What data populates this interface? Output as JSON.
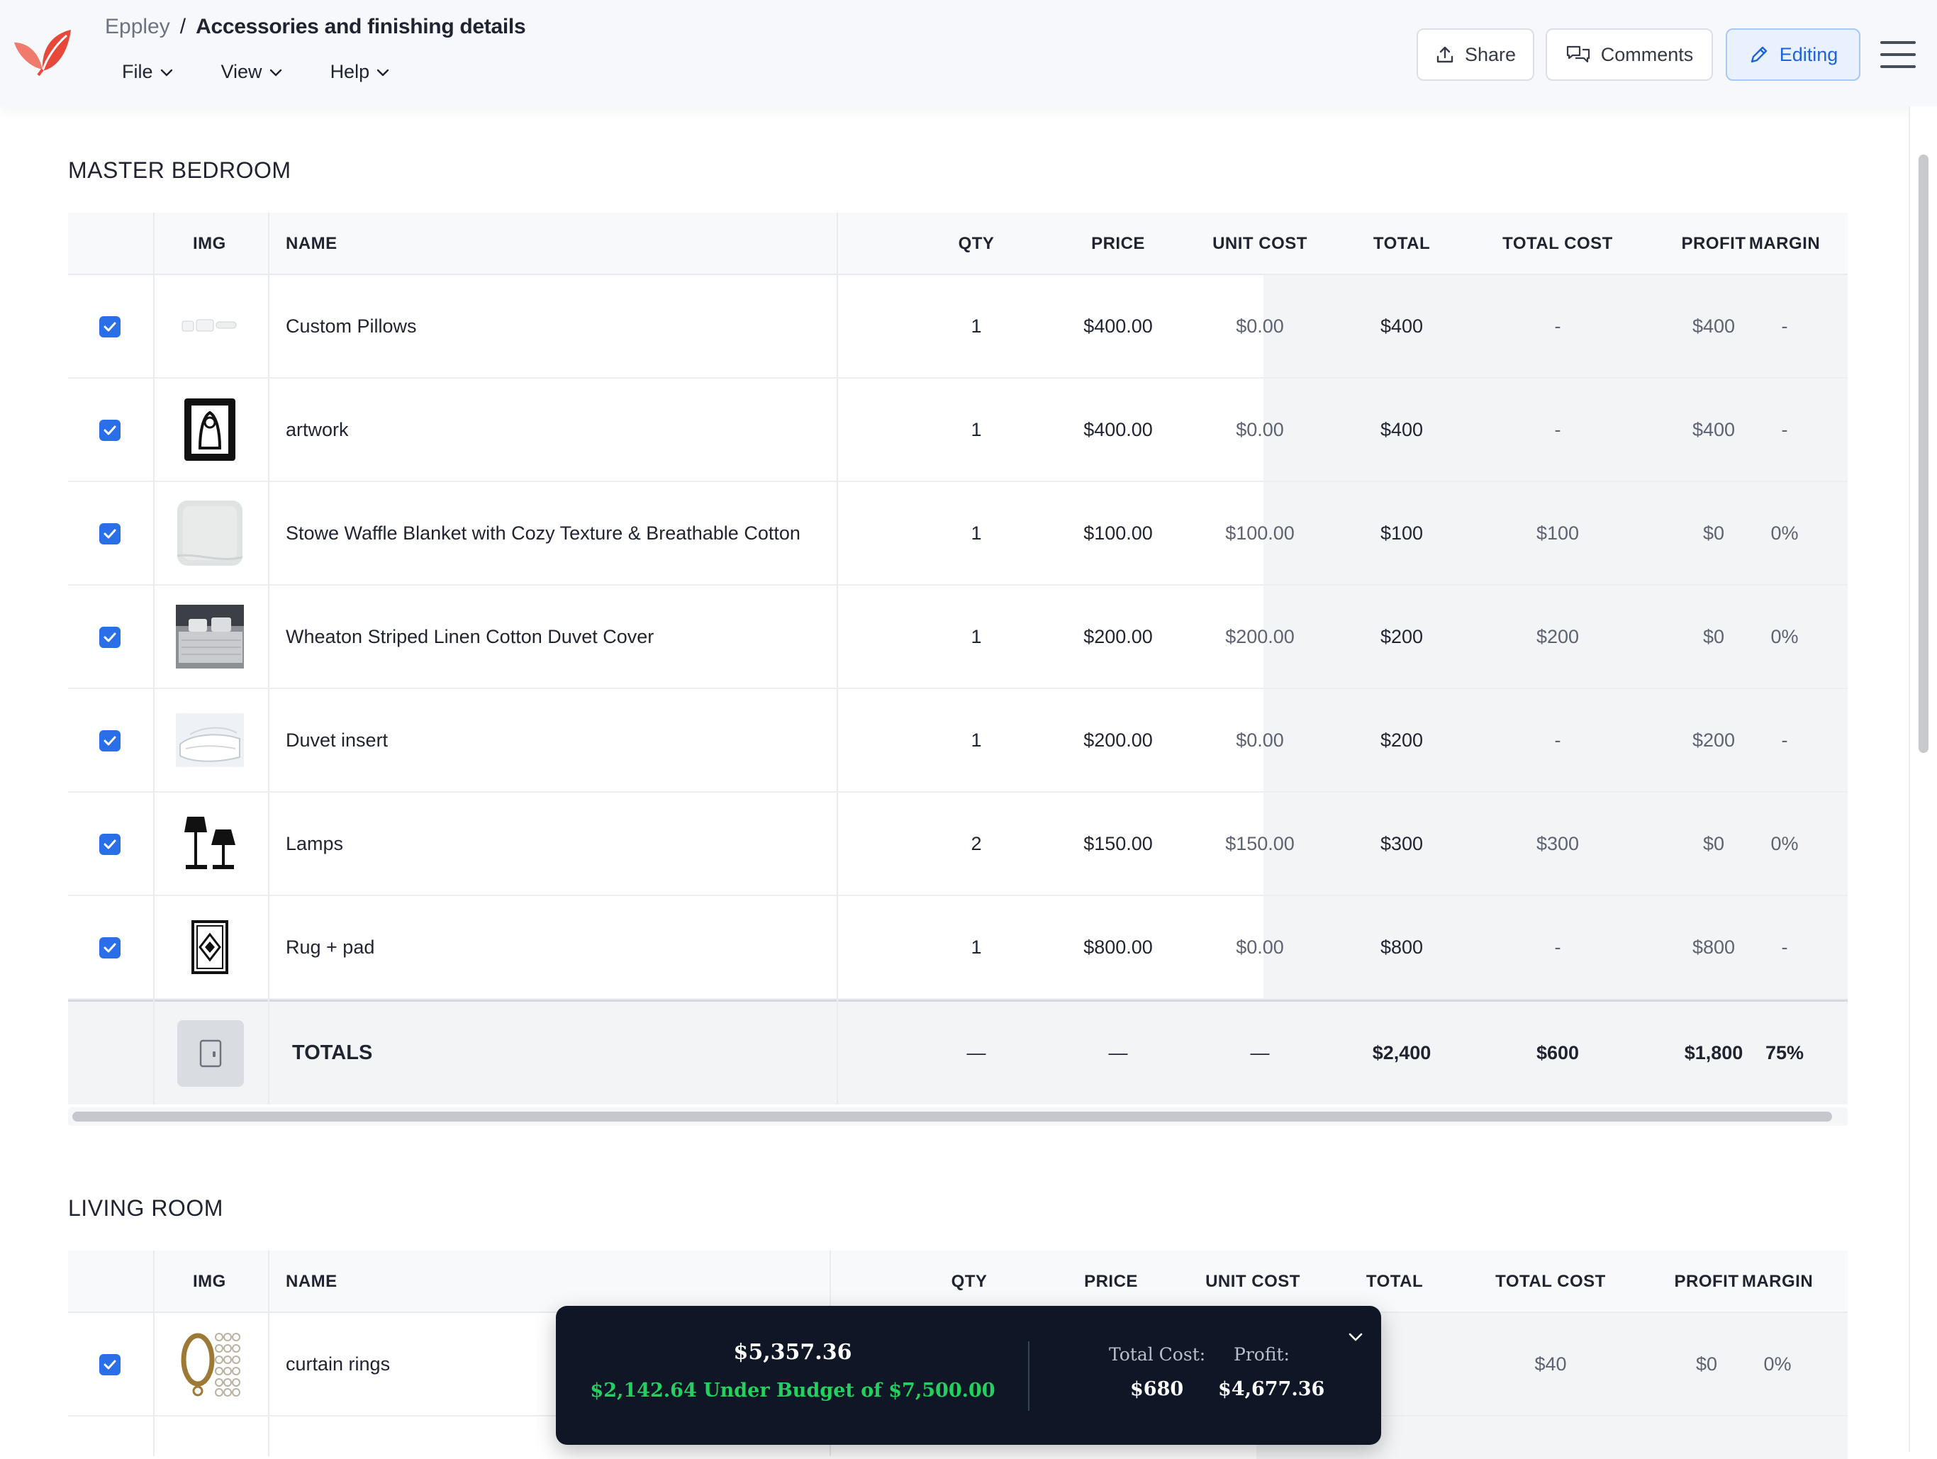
{
  "app": {
    "breadcrumb": {
      "project": "Eppley",
      "separator": "/",
      "document": "Accessories and finishing details"
    },
    "menus": [
      {
        "label": "File"
      },
      {
        "label": "View"
      },
      {
        "label": "Help"
      }
    ],
    "buttons": {
      "share": "Share",
      "comments": "Comments",
      "editing": "Editing"
    }
  },
  "columns": {
    "img": "IMG",
    "name": "NAME",
    "qty": "QTY",
    "price": "PRICE",
    "unit_cost": "UNIT COST",
    "total": "TOTAL",
    "total_cost": "TOTAL COST",
    "profit": "PROFIT",
    "margin": "MARGIN"
  },
  "sections": [
    {
      "title": "MASTER BEDROOM",
      "rows": [
        {
          "thumb": "pillows-icon",
          "name": "Custom Pillows",
          "qty": "1",
          "price": "$400.00",
          "unit_cost": "$0.00",
          "total": "$400",
          "total_cost": "-",
          "profit": "$400",
          "margin": "-",
          "checked": true
        },
        {
          "thumb": "artwork-icon",
          "name": "artwork",
          "qty": "1",
          "price": "$400.00",
          "unit_cost": "$0.00",
          "total": "$400",
          "total_cost": "-",
          "profit": "$400",
          "margin": "-",
          "checked": true
        },
        {
          "thumb": "blanket-icon",
          "name": "Stowe Waffle Blanket with Cozy Texture & Breathable Cotton",
          "qty": "1",
          "price": "$100.00",
          "unit_cost": "$100.00",
          "total": "$100",
          "total_cost": "$100",
          "profit": "$0",
          "margin": "0%",
          "checked": true
        },
        {
          "thumb": "duvet-cover-icon",
          "name": "Wheaton Striped Linen Cotton Duvet Cover",
          "qty": "1",
          "price": "$200.00",
          "unit_cost": "$200.00",
          "total": "$200",
          "total_cost": "$200",
          "profit": "$0",
          "margin": "0%",
          "checked": true
        },
        {
          "thumb": "duvet-insert-icon",
          "name": "Duvet insert",
          "qty": "1",
          "price": "$200.00",
          "unit_cost": "$0.00",
          "total": "$200",
          "total_cost": "-",
          "profit": "$200",
          "margin": "-",
          "checked": true
        },
        {
          "thumb": "lamps-icon",
          "name": "Lamps",
          "qty": "2",
          "price": "$150.00",
          "unit_cost": "$150.00",
          "total": "$300",
          "total_cost": "$300",
          "profit": "$0",
          "margin": "0%",
          "checked": true
        },
        {
          "thumb": "rug-icon",
          "name": "Rug + pad",
          "qty": "1",
          "price": "$800.00",
          "unit_cost": "$0.00",
          "total": "$800",
          "total_cost": "-",
          "profit": "$800",
          "margin": "-",
          "checked": true
        }
      ],
      "totals": {
        "label": "TOTALS",
        "qty": "—",
        "price": "—",
        "unit_cost": "—",
        "total": "$2,400",
        "total_cost": "$600",
        "profit": "$1,800",
        "margin": "75%"
      }
    },
    {
      "title": "LIVING ROOM",
      "rows": [
        {
          "thumb": "curtain-rings-icon",
          "name": "curtain rings",
          "total_cost": "$40",
          "profit": "$0",
          "margin": "0%",
          "checked": true
        }
      ]
    }
  ],
  "budget": {
    "amount": "$5,357.36",
    "status": "$2,142.64 Under Budget of $7,500.00",
    "total_cost_label": "Total Cost:",
    "total_cost": "$680",
    "profit_label": "Profit:",
    "profit": "$4,677.36"
  },
  "colors": {
    "accent": "#2a6ee8",
    "budget_bg": "#0f1726",
    "under_budget": "#22d15f",
    "logo": "#e8483a"
  }
}
